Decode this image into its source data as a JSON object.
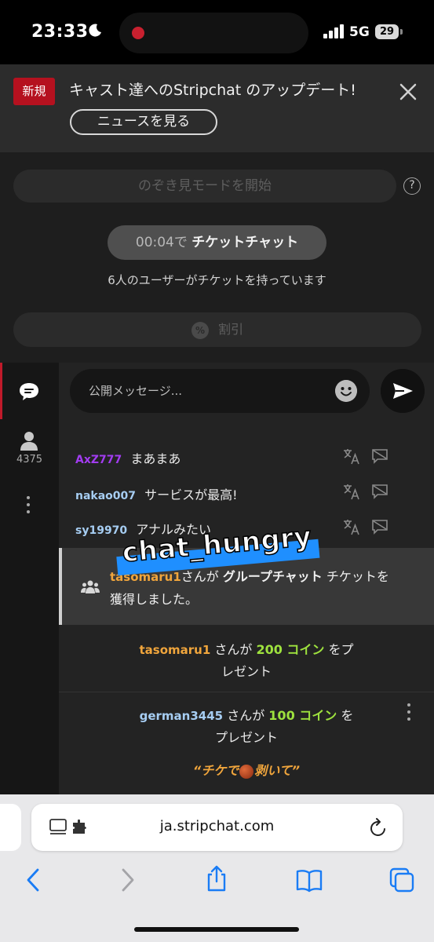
{
  "status_bar": {
    "time": "23:33",
    "moon_icon": "moon-icon",
    "network": "5G",
    "battery": "29"
  },
  "banner": {
    "badge": "新規",
    "title": "キャスト達へのStripchat のアップデート!",
    "news_button": "ニュースを見る",
    "close_icon": "close-icon"
  },
  "stream": {
    "peek_button": "のぞき見モードを開始",
    "help_icon": "?",
    "ticket_time": "00:04で",
    "ticket_label": "チケットチャット",
    "ticket_users_text": "6人のユーザーがチケットを持っています",
    "discount_icon": "%",
    "discount_button": "割引"
  },
  "chat": {
    "viewer_count": "4375",
    "input_placeholder": "公開メッセージ...",
    "messages": [
      {
        "user": "AxZ777",
        "user_color": "#a23cf0",
        "text": "まあまあ"
      },
      {
        "user": "nakao007",
        "user_color": "#a6cdf2",
        "text": "サービスが最高!"
      },
      {
        "user": "sy19970",
        "user_color": "#a6cdf2",
        "text": "アナルみたい"
      }
    ],
    "system_message": {
      "user": "tasomaru1",
      "mid": "さんが ",
      "bold": "グループチャット",
      "tail": " チケットを",
      "line2": "獲得しました。"
    },
    "tips": [
      {
        "user": "tasomaru1",
        "mid": " さんが ",
        "amount": "200 コイン",
        "tail": " をプ",
        "line2": "レゼント"
      },
      {
        "user": "german3445",
        "mid": " さんが ",
        "amount": "100 コイン",
        "tail": " を",
        "line2": "プレゼント"
      }
    ],
    "tip_message_pre": "“チケで",
    "tip_message_post": "剥いて”",
    "sticker_text": "chat_hungry"
  },
  "browser": {
    "url": "ja.stripchat.com"
  },
  "colors": {
    "accent_red": "#b5111f",
    "coin_green": "#9ee23e",
    "orange_user": "#f0a53c",
    "safari_blue": "#1a7cf5"
  }
}
